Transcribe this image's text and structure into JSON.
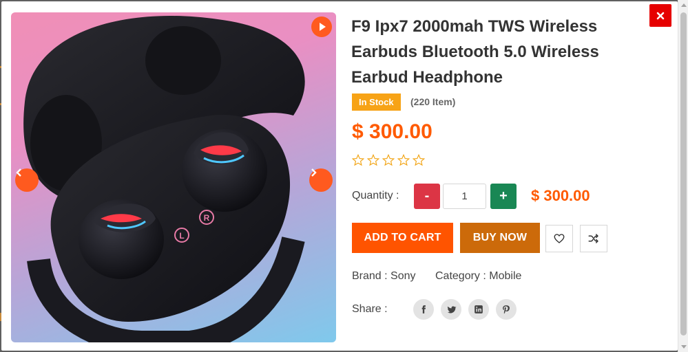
{
  "product": {
    "title": "F9 Ipx7 2000mah TWS Wireless Earbuds Bluetooth 5.0 Wireless Earbud Headphone",
    "stock_status": "In Stock",
    "stock_count": "(220 Item)",
    "price": "$ 300.00",
    "rating": 0
  },
  "quantity": {
    "label": "Quantity :",
    "minus": "-",
    "value": "1",
    "plus": "+",
    "total": "$ 300.00"
  },
  "actions": {
    "add_to_cart": "ADD TO CART",
    "buy_now": "BUY NOW",
    "wishlist_icon": "heart-icon",
    "compare_icon": "shuffle-icon"
  },
  "meta": {
    "brand": "Brand : Sony",
    "category": "Category : Mobile"
  },
  "share": {
    "label": "Share :",
    "networks": [
      "facebook",
      "twitter",
      "linkedin",
      "pinterest"
    ]
  },
  "gallery": {
    "earbud_letters": [
      "L",
      "R"
    ]
  },
  "colors": {
    "accent": "#ff5a00",
    "stock_badge": "#f7a316",
    "buy_now": "#cc6a0a",
    "minus": "#dc3545",
    "plus": "#198754",
    "close": "#e60000"
  }
}
